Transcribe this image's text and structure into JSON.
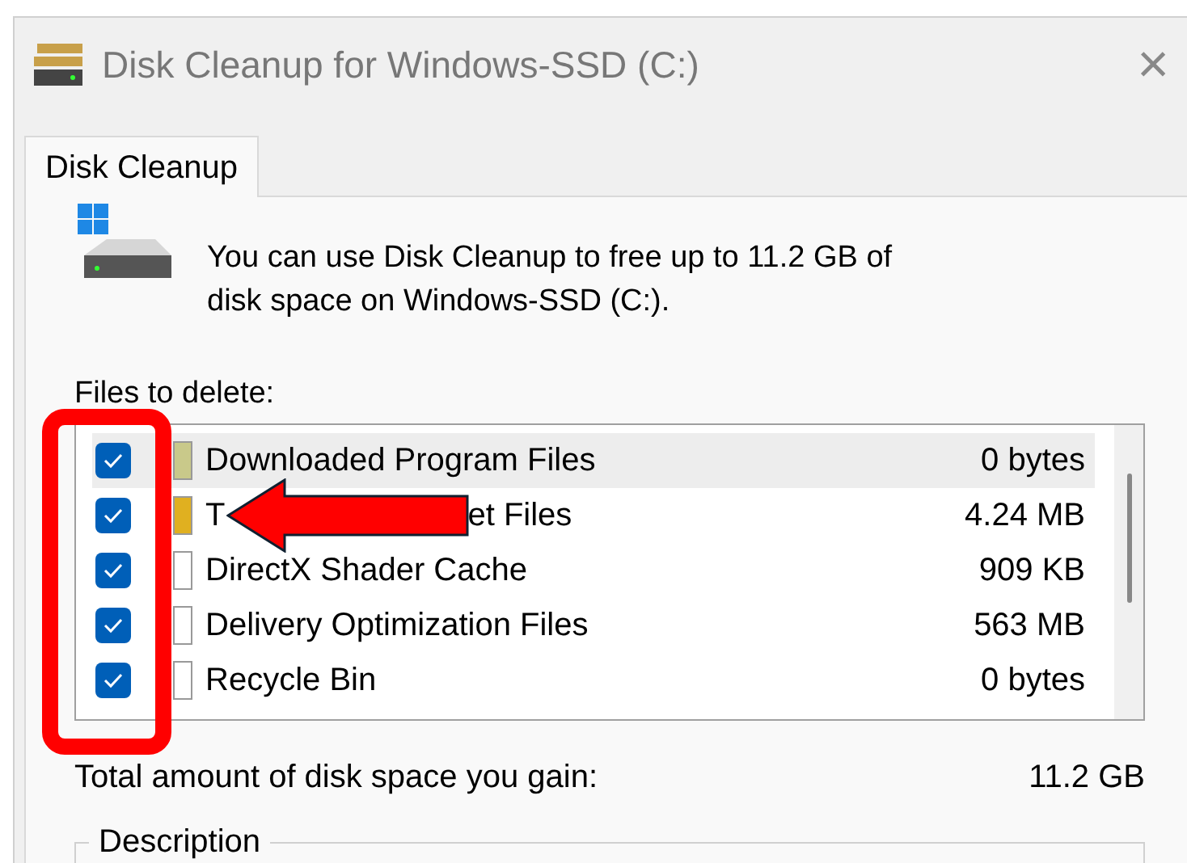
{
  "window": {
    "title": "Disk Cleanup for Windows-SSD (C:)",
    "close": "×"
  },
  "tabs": [
    {
      "label": "Disk Cleanup",
      "selected": true
    }
  ],
  "intro": "You can use Disk Cleanup to free up to 11.2 GB of disk space on Windows-SSD (C:).",
  "files_label": "Files to delete:",
  "files": [
    {
      "name": "Downloaded Program Files",
      "size": "0 bytes",
      "checked": true,
      "selected": true
    },
    {
      "name": "T",
      "name_after_arrow": "et Files",
      "size": "4.24 MB",
      "checked": true,
      "selected": false
    },
    {
      "name": "DirectX Shader Cache",
      "size": "909 KB",
      "checked": true,
      "selected": false
    },
    {
      "name": "Delivery Optimization Files",
      "size": "563 MB",
      "checked": true,
      "selected": false
    },
    {
      "name": "Recycle Bin",
      "size": "0 bytes",
      "checked": true,
      "selected": false
    }
  ],
  "total": {
    "label": "Total amount of disk space you gain:",
    "value": "11.2 GB"
  },
  "description": {
    "legend": "Description"
  }
}
